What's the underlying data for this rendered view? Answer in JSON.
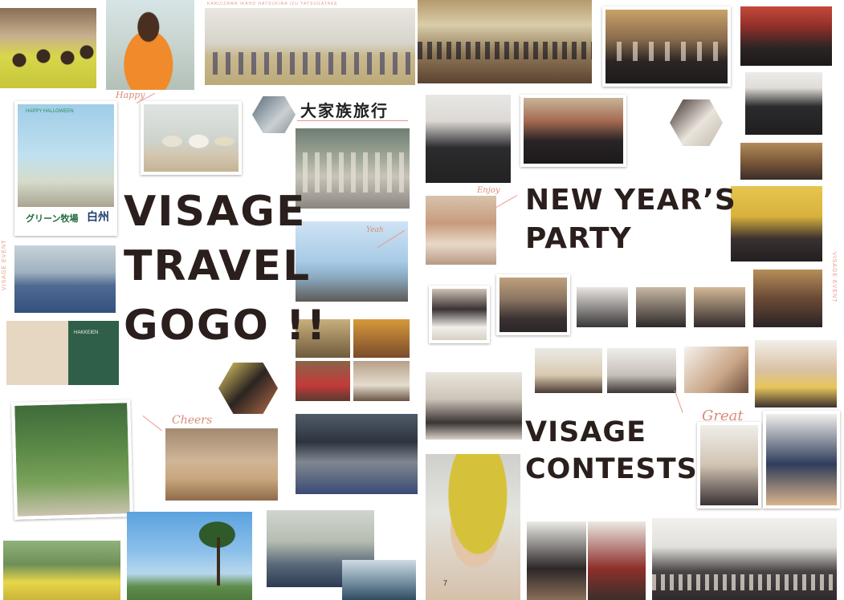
{
  "top_caption": "KARUIZAWA  IKAHO  HATSUKIRA  IZU  YATSUGATAKE",
  "titles": {
    "travel_line1": "VISAGE",
    "travel_line2": "TRAVEL",
    "travel_line3": "GOGO !!",
    "party_line1": "NEW YEAR’S",
    "party_line2": "PARTY",
    "contest_line1": "VISAGE",
    "contest_line2": "CONTESTS"
  },
  "family_trip": "大家族旅行",
  "side_labels": {
    "left": "VISAGE  EVENT",
    "right": "VISAGE  EVENT"
  },
  "script_words": {
    "happy": "Happy",
    "yeah": "Yeah",
    "enjoy": "Enjoy",
    "cheers": "Cheers",
    "great": "Great"
  },
  "photo_text": {
    "halloween": "HAPPY HALLOWEEN",
    "green_farm": "グリーン牧場",
    "shiroshu": "白州",
    "hotel_sign": "HAKKEIEN"
  },
  "page_number": "7",
  "palette": {
    "accent": "#e7988a",
    "text": "#2a1f1c"
  }
}
